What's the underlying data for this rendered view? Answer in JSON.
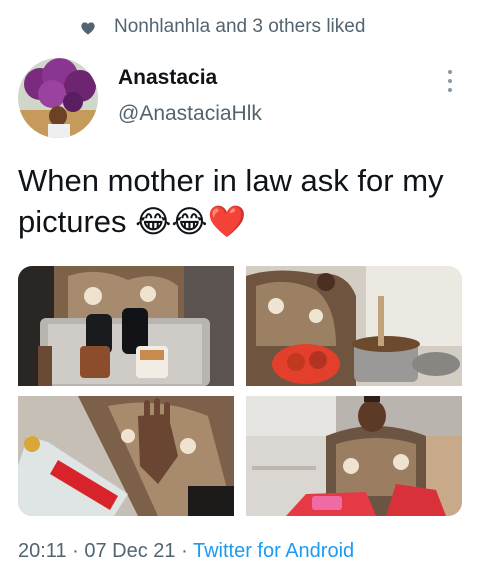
{
  "social_context": {
    "text": "Nonhlanhla and 3 others liked",
    "icon": "heart-icon"
  },
  "author": {
    "name": "Anastacia",
    "handle": "@AnastaciaHlk"
  },
  "tweet": {
    "text": "When mother in law ask for my pictures 😂😂❤️"
  },
  "photos": [
    {
      "icon": "photo-tray-mugs"
    },
    {
      "icon": "photo-cooking-pot"
    },
    {
      "icon": "photo-bottle-hand"
    },
    {
      "icon": "photo-smiling-woman"
    }
  ],
  "meta": {
    "time": "20:11",
    "sep1": " · ",
    "date": "07 Dec 21",
    "sep2": " · ",
    "source": "Twitter for Android"
  },
  "colors": {
    "secondary_text": "#536471",
    "link": "#1d9bf0",
    "primary_text": "#0f1419"
  }
}
